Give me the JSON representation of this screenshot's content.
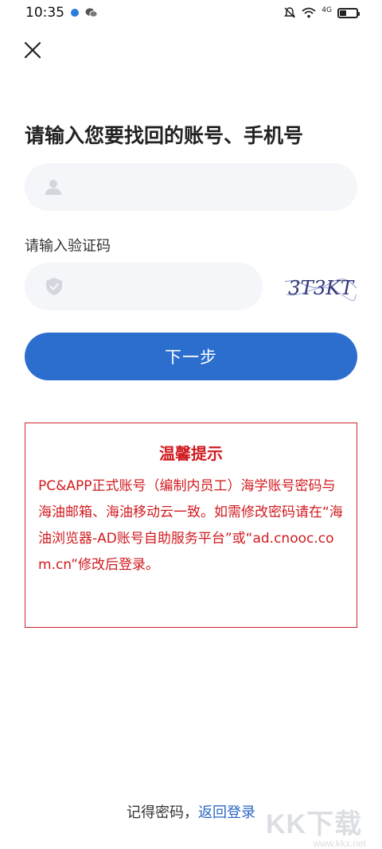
{
  "status_bar": {
    "time": "10:35",
    "network": "4G",
    "icons": [
      "bluetooth-icon",
      "wechat-icon",
      "mute-icon",
      "wifi-icon",
      "battery-icon"
    ]
  },
  "page": {
    "title": "请输入您要找回的账号、手机号",
    "code_label": "请输入验证码",
    "next_label": "下一步"
  },
  "account_field": {
    "placeholder": "",
    "value": ""
  },
  "code_field": {
    "placeholder": "",
    "value": ""
  },
  "captcha": {
    "text": "3T3KT"
  },
  "notice": {
    "title": "温馨提示",
    "body": "PC&APP正式账号（编制内员工）海学账号密码与海油邮箱、海油移动云一致。如需修改密码请在“海油浏览器-AD账号自助服务平台”或“ad.cnooc.com.cn”修改后登录。"
  },
  "footer": {
    "remember": "记得密码，",
    "back_login": "返回登录"
  },
  "watermark": {
    "logo": "KK下载",
    "url": "www.kkx.net"
  },
  "colors": {
    "primary": "#2b6ecd",
    "alert_red": "#d11a1f",
    "input_bg": "#f4f6f9",
    "link_blue": "#2a66c6"
  }
}
